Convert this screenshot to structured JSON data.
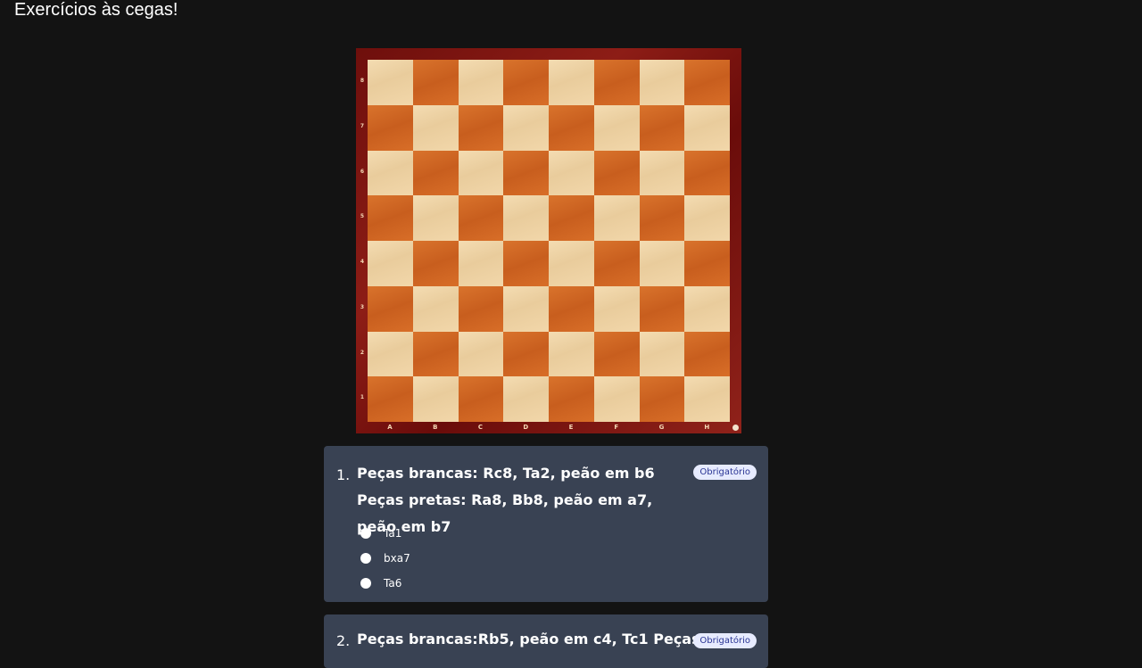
{
  "page": {
    "title": "Exercícios às cegas!"
  },
  "board": {
    "ranks": [
      "8",
      "7",
      "6",
      "5",
      "4",
      "3",
      "2",
      "1"
    ],
    "files": [
      "A",
      "B",
      "C",
      "D",
      "E",
      "F",
      "G",
      "H"
    ],
    "colors": {
      "frame": "#7a1410",
      "light_square": "#efd5a8",
      "dark_square": "#d06a26"
    }
  },
  "questions": [
    {
      "number": "1.",
      "text": "Peças brancas: Rc8, Ta2, peão em b6 Peças pretas: Ra8, Bb8, peão em a7, peão em b7",
      "badge": "Obrigatório",
      "options": [
        "Ta1",
        "bxa7",
        "Ta6"
      ]
    },
    {
      "number": "2.",
      "text": "Peças brancas:Rb5, peão em c4, Tc1 Peças",
      "badge": "Obrigatório",
      "options": []
    }
  ],
  "colors": {
    "background": "#131313",
    "card": "#394253",
    "badge_bg": "#e7ebff",
    "badge_text": "#2a3593"
  }
}
